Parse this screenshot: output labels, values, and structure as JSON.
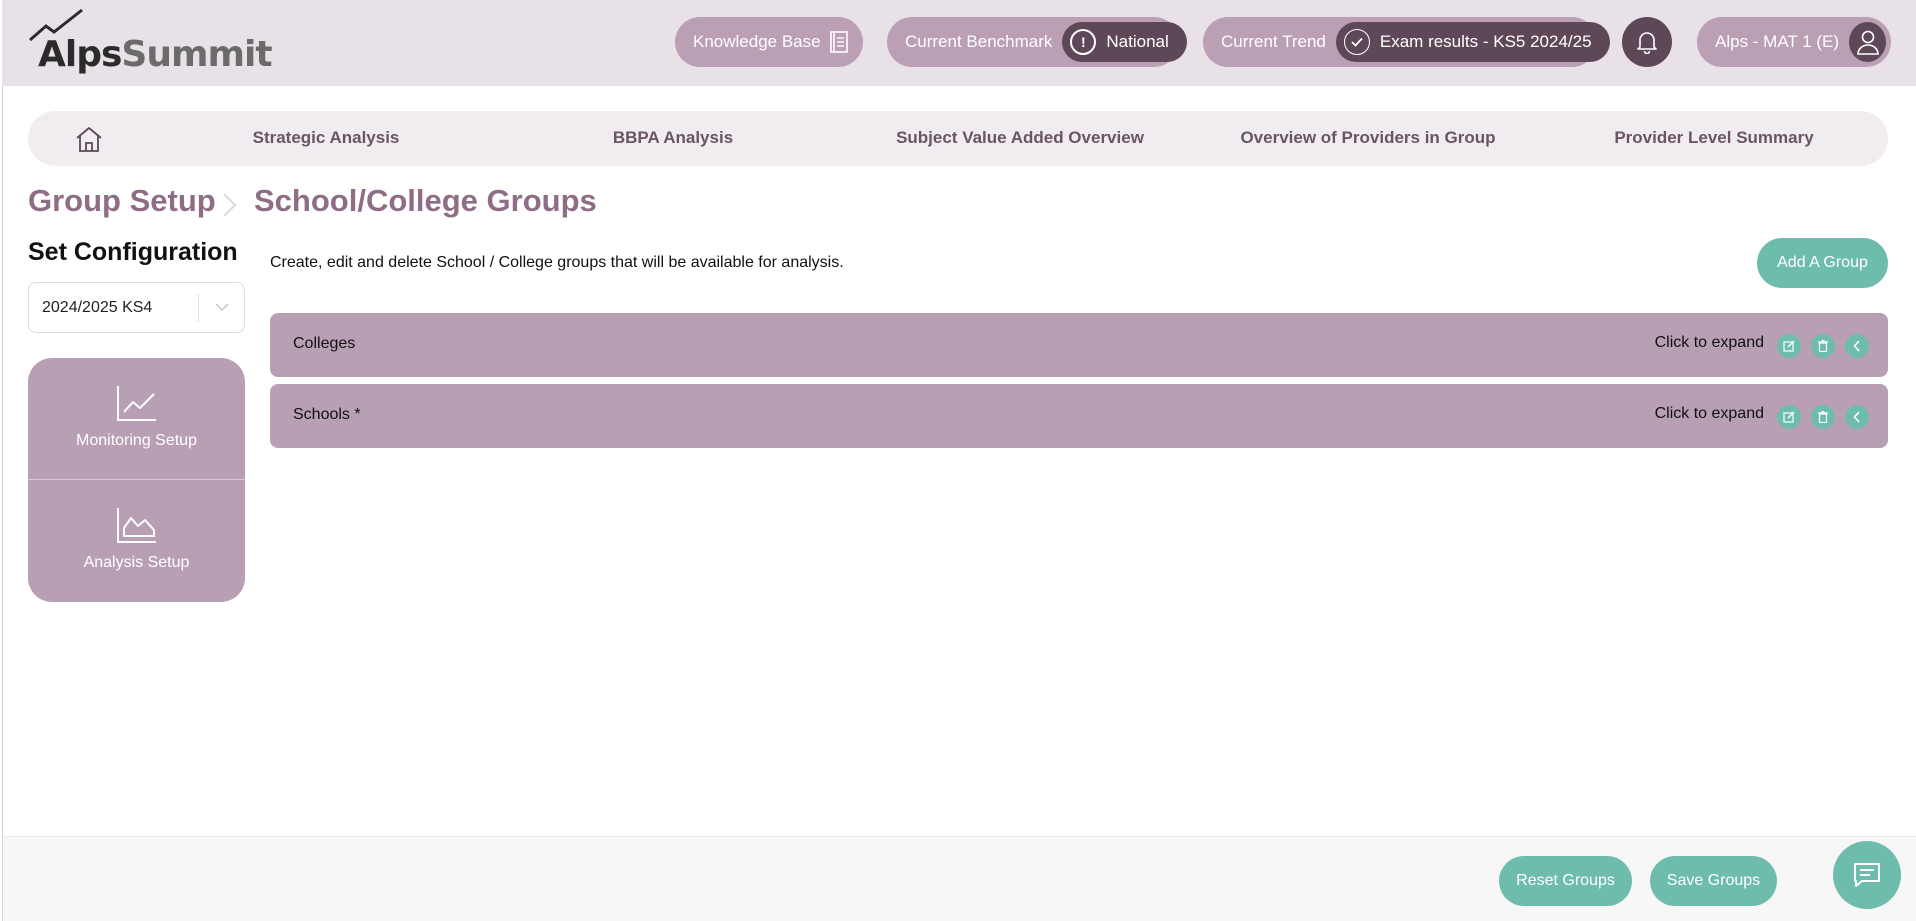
{
  "brand": {
    "logo_text_a": "Alps",
    "logo_text_b": "Summit"
  },
  "header": {
    "knowledge_base": "Knowledge Base",
    "benchmark_label": "Current Benchmark",
    "benchmark_value": "National",
    "trend_label": "Current Trend",
    "trend_value": "Exam results - KS5 2024/25",
    "user_label": "Alps - MAT 1 (E)",
    "icons": [
      "book-icon",
      "alert-circle-icon",
      "check-circle-icon",
      "bell-icon",
      "user-icon"
    ]
  },
  "nav": {
    "home_icon": "home-icon",
    "items": [
      {
        "label": "Strategic Analysis"
      },
      {
        "label": "BBPA Analysis"
      },
      {
        "label": "Subject Value Added Overview"
      },
      {
        "label": "Overview of Providers in Group"
      },
      {
        "label": "Provider Level Summary"
      }
    ]
  },
  "breadcrumb": {
    "parent": "Group Setup",
    "current": "School/College Groups"
  },
  "sidebar": {
    "title": "Set Configuration",
    "selected_config": "2024/2025 KS4",
    "items": [
      {
        "label": "Monitoring Setup",
        "icon": "line-chart-icon"
      },
      {
        "label": "Analysis Setup",
        "icon": "area-chart-icon"
      }
    ]
  },
  "main": {
    "description": "Create, edit and delete School / College groups that will be available for analysis.",
    "add_group_label": "Add A Group",
    "groups": [
      {
        "name": "Colleges",
        "expand_label": "Click to expand"
      },
      {
        "name": "Schools *",
        "expand_label": "Click to expand"
      }
    ]
  },
  "footer": {
    "reset_label": "Reset Groups",
    "save_label": "Save Groups",
    "chat_icon": "chat-icon"
  },
  "colors": {
    "header_bg": "#e9e1e8",
    "pill": "#bb9fb4",
    "pill_dark": "#5e4858",
    "accent_teal": "#6dbcac",
    "group_row": "#b99fb3",
    "breadcrumb": "#8e6e86"
  }
}
